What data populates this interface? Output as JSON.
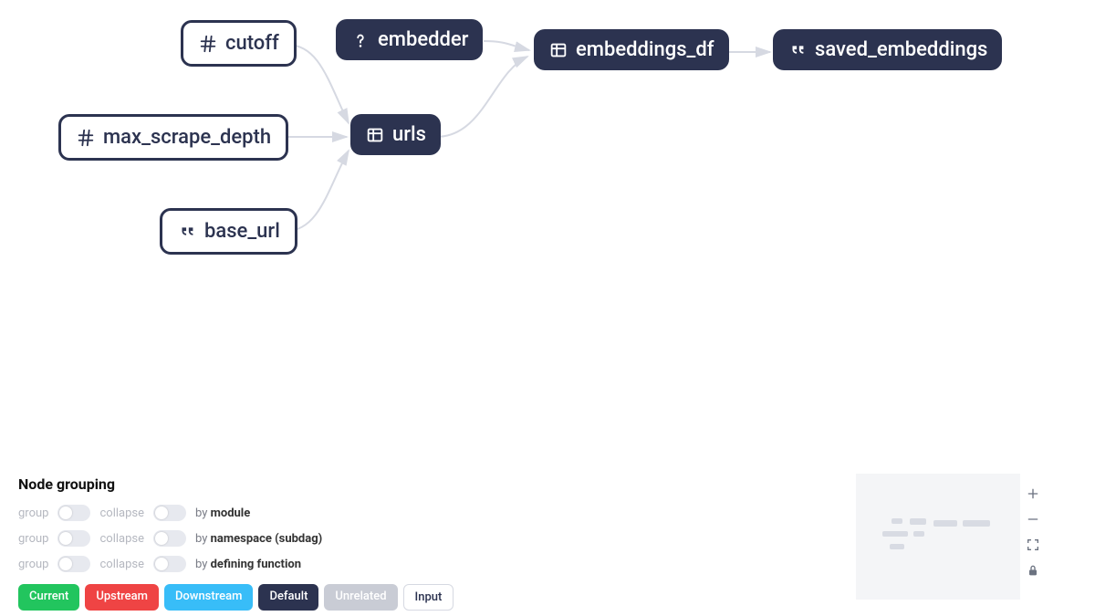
{
  "nodes": {
    "cutoff": {
      "label": "cutoff",
      "icon": "hash",
      "style": "outline"
    },
    "max_scrape_depth": {
      "label": "max_scrape_depth",
      "icon": "hash",
      "style": "outline"
    },
    "base_url": {
      "label": "base_url",
      "icon": "quote",
      "style": "outline"
    },
    "embedder": {
      "label": "embedder",
      "icon": "question",
      "style": "solid"
    },
    "urls": {
      "label": "urls",
      "icon": "table",
      "style": "solid"
    },
    "embeddings_df": {
      "label": "embeddings_df",
      "icon": "table",
      "style": "solid"
    },
    "saved_embeddings": {
      "label": "saved_embeddings",
      "icon": "quote",
      "style": "solid"
    }
  },
  "panel": {
    "title": "Node grouping",
    "rows": [
      {
        "group_label": "group",
        "collapse_label": "collapse",
        "prefix": "by",
        "bold": "module"
      },
      {
        "group_label": "group",
        "collapse_label": "collapse",
        "prefix": "by",
        "bold": "namespace (subdag)"
      },
      {
        "group_label": "group",
        "collapse_label": "collapse",
        "prefix": "by",
        "bold": "defining function"
      }
    ],
    "badges": {
      "current": "Current",
      "upstream": "Upstream",
      "downstream": "Downstream",
      "default": "Default",
      "unrelated": "Unrelated",
      "input": "Input"
    }
  }
}
